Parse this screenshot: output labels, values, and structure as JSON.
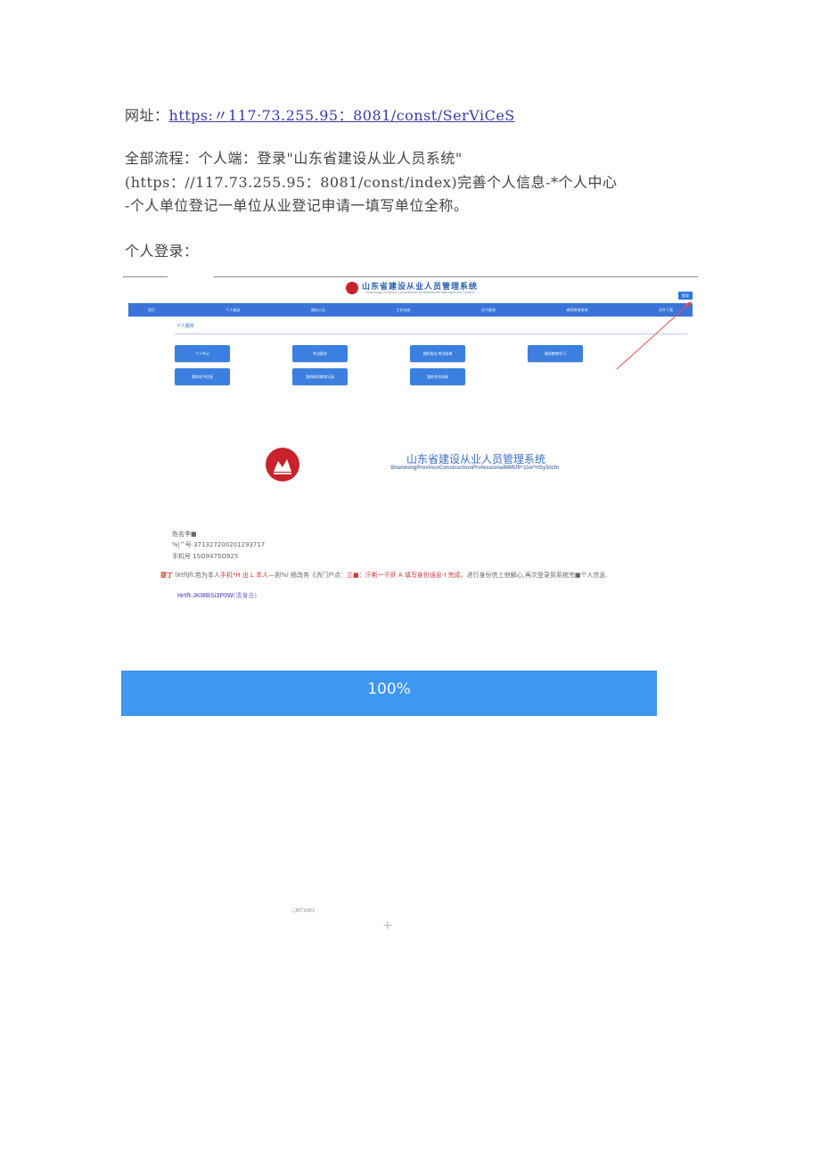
{
  "doc": {
    "url_label": "网址：",
    "url_link": "https:〃117·73.255.95：8081∕const∕SerViCeS",
    "flow_line1": "全部流程：个人端：登录\"山东省建设从业人员系统\"",
    "flow_line2": "(https：//117.73.255.95：8081∕const∕index)完善个人信息-*个人中心",
    "flow_line3": "-个人单位登记一单位从业登记申请一填写单位全称。",
    "section_login": "个人登录："
  },
  "screenshot1": {
    "title": "山东省建设从业人员管理系统",
    "subtitle": "Shandong Province Construction Professionals Management System",
    "login_button": "登录",
    "nav": [
      "首页",
      "个人服务",
      "服务公告",
      "工作动态",
      "证书查询",
      "继续教育查询",
      "文件下载"
    ],
    "section": "个人服务",
    "buttons": [
      "个人中心",
      "考试报名",
      "我的报名/考试结果",
      "继续教育学习",
      "我的证书信息",
      "我的继续教育记录",
      "我的考试成绩"
    ]
  },
  "screenshot2": {
    "title": "山东省建设从业人员管理系统",
    "subtitle": "ShandongProvinceConstructionProfessionalMMU9^11w*rtSyStcfn",
    "name_line": "姓名李■",
    "id_line": "%|^号 371327200201293717",
    "phone_line": "手机号 1SO9475O925",
    "notice_a": "提丁",
    "notice_b": " lXtflJfl.若为本人",
    "notice_c": "手机",
    "notice_d": "*H 出 L 本人",
    "notice_e": "—则%l 统改务《济门户点：",
    "notice_f": "立■：汗斯一千肝 A 填写身份误息-I 完成",
    "notice_g": "，进行身份信上他解心,再次登录到系统完■个人信息.",
    "verify_link": "Hrtft-JKMBSi3P0W",
    "verify_suffix": "(清身击)",
    "progress": "100%",
    "footer_tiny": "(JBTirtlfO",
    "plus": "+"
  }
}
